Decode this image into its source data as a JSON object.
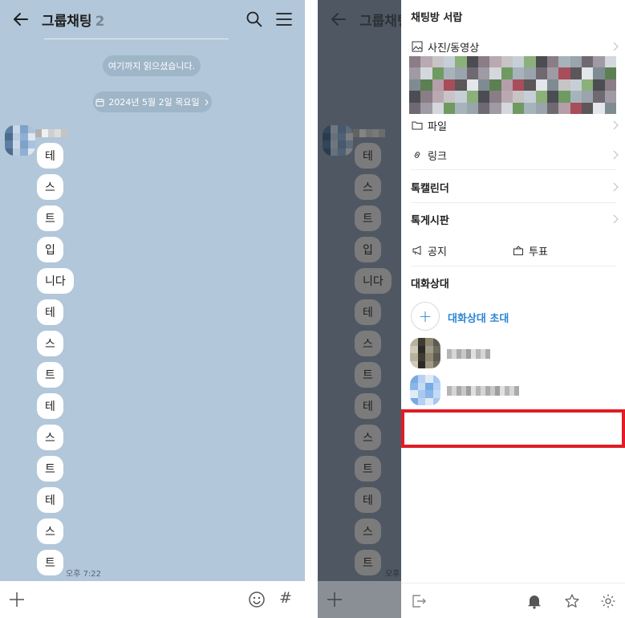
{
  "chat": {
    "title": "그룹채팅",
    "member_count": "2",
    "read_divider": "여기까지 읽으셨습니다.",
    "date_divider": "2024년 5월 2일 목요일",
    "messages": [
      "테",
      "스",
      "트",
      "입",
      "니다",
      "테",
      "스",
      "트",
      "테",
      "스",
      "트",
      "테",
      "스",
      "트"
    ],
    "last_time": "오후 7:22"
  },
  "drawer": {
    "title": "채팅방 서랍",
    "photos_label": "사진/동영상",
    "files_label": "파일",
    "links_label": "링크",
    "calendar_label": "톡캘린더",
    "board_label": "톡게시판",
    "notice_label": "공지",
    "poll_label": "투표",
    "members_title": "대화상대",
    "invite_label": "대화상대 초대"
  },
  "colors": {
    "chat_bg": "#b2c7d9",
    "dim_bg": "#4f5862",
    "accent": "#2b86d4",
    "highlight": "#e21b24"
  },
  "icons": {
    "back": "back-arrow-icon",
    "search": "search-icon",
    "menu": "hamburger-menu-icon",
    "plus": "plus-icon",
    "emoji": "emoji-icon",
    "hash": "hash-icon",
    "exit": "exit-icon",
    "bell": "bell-icon",
    "star": "star-icon",
    "gear": "gear-icon"
  }
}
